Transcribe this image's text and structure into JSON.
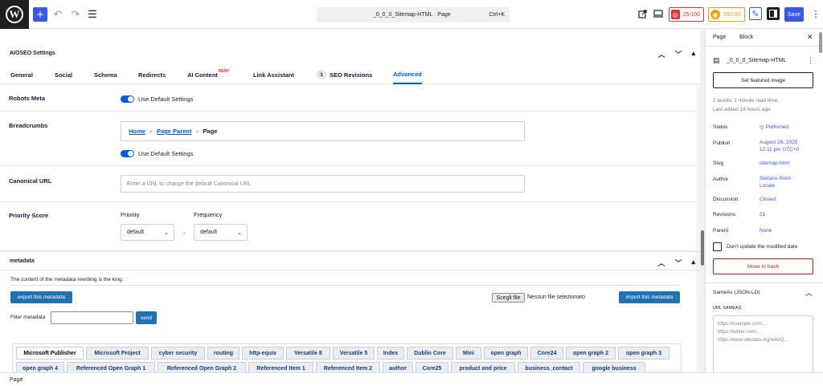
{
  "topbar": {
    "logo_glyph": "W",
    "plus_label": "+",
    "undo_label": "↶",
    "redo_label": "↷",
    "list_label": "☰",
    "command_title": "_0_0_0_Sitemap-HTML · Page",
    "command_shortcut": "Ctrl+K",
    "score1": "25/100",
    "score2": "59/100",
    "save_label": "Save",
    "colors": {
      "accent": "#3858e9",
      "bad": "#d63638",
      "warn": "#f0a000"
    }
  },
  "aioseo": {
    "title": "AIOSEO Settings",
    "tabs": [
      "General",
      "Social",
      "Schema",
      "Redirects",
      "AI Content",
      "Link Assistant",
      "SEO Revisions",
      "Advanced"
    ],
    "new_badge": "NEW!",
    "revisions_count": "1",
    "robots_label": "Robots Meta",
    "use_default": "Use Default Settings",
    "breadcrumbs_label": "Breadcrumbs",
    "breadcrumb": {
      "home": "Home",
      "sep": "»",
      "parent": "Page Parent",
      "current": "Page"
    },
    "canonical_label": "Canonical URL",
    "canonical_placeholder": "Enter a URL to change the default Canonical URL",
    "priority_label": "Priority Score",
    "priority_sub": "Priority",
    "frequency_sub": "Frequency",
    "priority_value": "default",
    "frequency_value": "default",
    "dash": "-"
  },
  "metadata": {
    "title": "metadata",
    "desc": "The content of the metadata rewriting is the king.",
    "export_btn": "export this metadata",
    "choose_file": "Scegli file",
    "no_file": "Nessun file selezionato",
    "import_btn": "import this metadata",
    "filter_label": "Filter metadata",
    "send_btn": "send",
    "tabs_row1": [
      "Microsoft Publisher",
      "Microsoft Project",
      "cyber security",
      "routing",
      "http-equiv",
      "Versatile 8",
      "Versatile 5",
      "Index",
      "Dublin Core",
      "Mini",
      "open graph",
      "Core24",
      "open graph 2",
      "open graph 3"
    ],
    "tabs_row2": [
      "open graph 4",
      "Referenced Open Graph 1",
      "Referenced Open Graph 2",
      "Referenced Item 1",
      "Referenced Item 2",
      "author",
      "Core25",
      "product and price",
      "business_contact",
      "google business"
    ]
  },
  "footer": {
    "label": "Page"
  },
  "sidebar": {
    "tab_page": "Page",
    "tab_block": "Block",
    "doc_title": "_0_0_0_Sitemap-HTML",
    "featured_btn": "Set featured image",
    "summary1": "2 words, 1 minute read time.",
    "summary2": "Last edited 18 hours ago.",
    "status_label": "Status",
    "status_value": "Published",
    "publish_label": "Publish",
    "publish_value1": "August 26, 2025",
    "publish_value2": "12:11 pm UTC+0",
    "slug_label": "Slug",
    "slug_value": "sitemap-html",
    "author_label": "Author",
    "author_value1": "Stefano-Root-",
    "author_value2": "Locale",
    "discussion_label": "Discussion",
    "discussion_value": "Closed",
    "revisions_label": "Revisions",
    "revisions_value": "21",
    "parent_label": "Parent",
    "parent_value": "None",
    "modified_label": "Don't update the modified date",
    "trash_btn": "Move to trash",
    "sameas_title": "SameAs (JSON-LD)",
    "url_sameas": "URL SAMEAS",
    "sameas_placeholder1": "https://example.com/...",
    "sameas_placeholder2": "https://twitter.com/...",
    "sameas_placeholder3": "https://www.wikidata.org/wiki/Q..."
  }
}
